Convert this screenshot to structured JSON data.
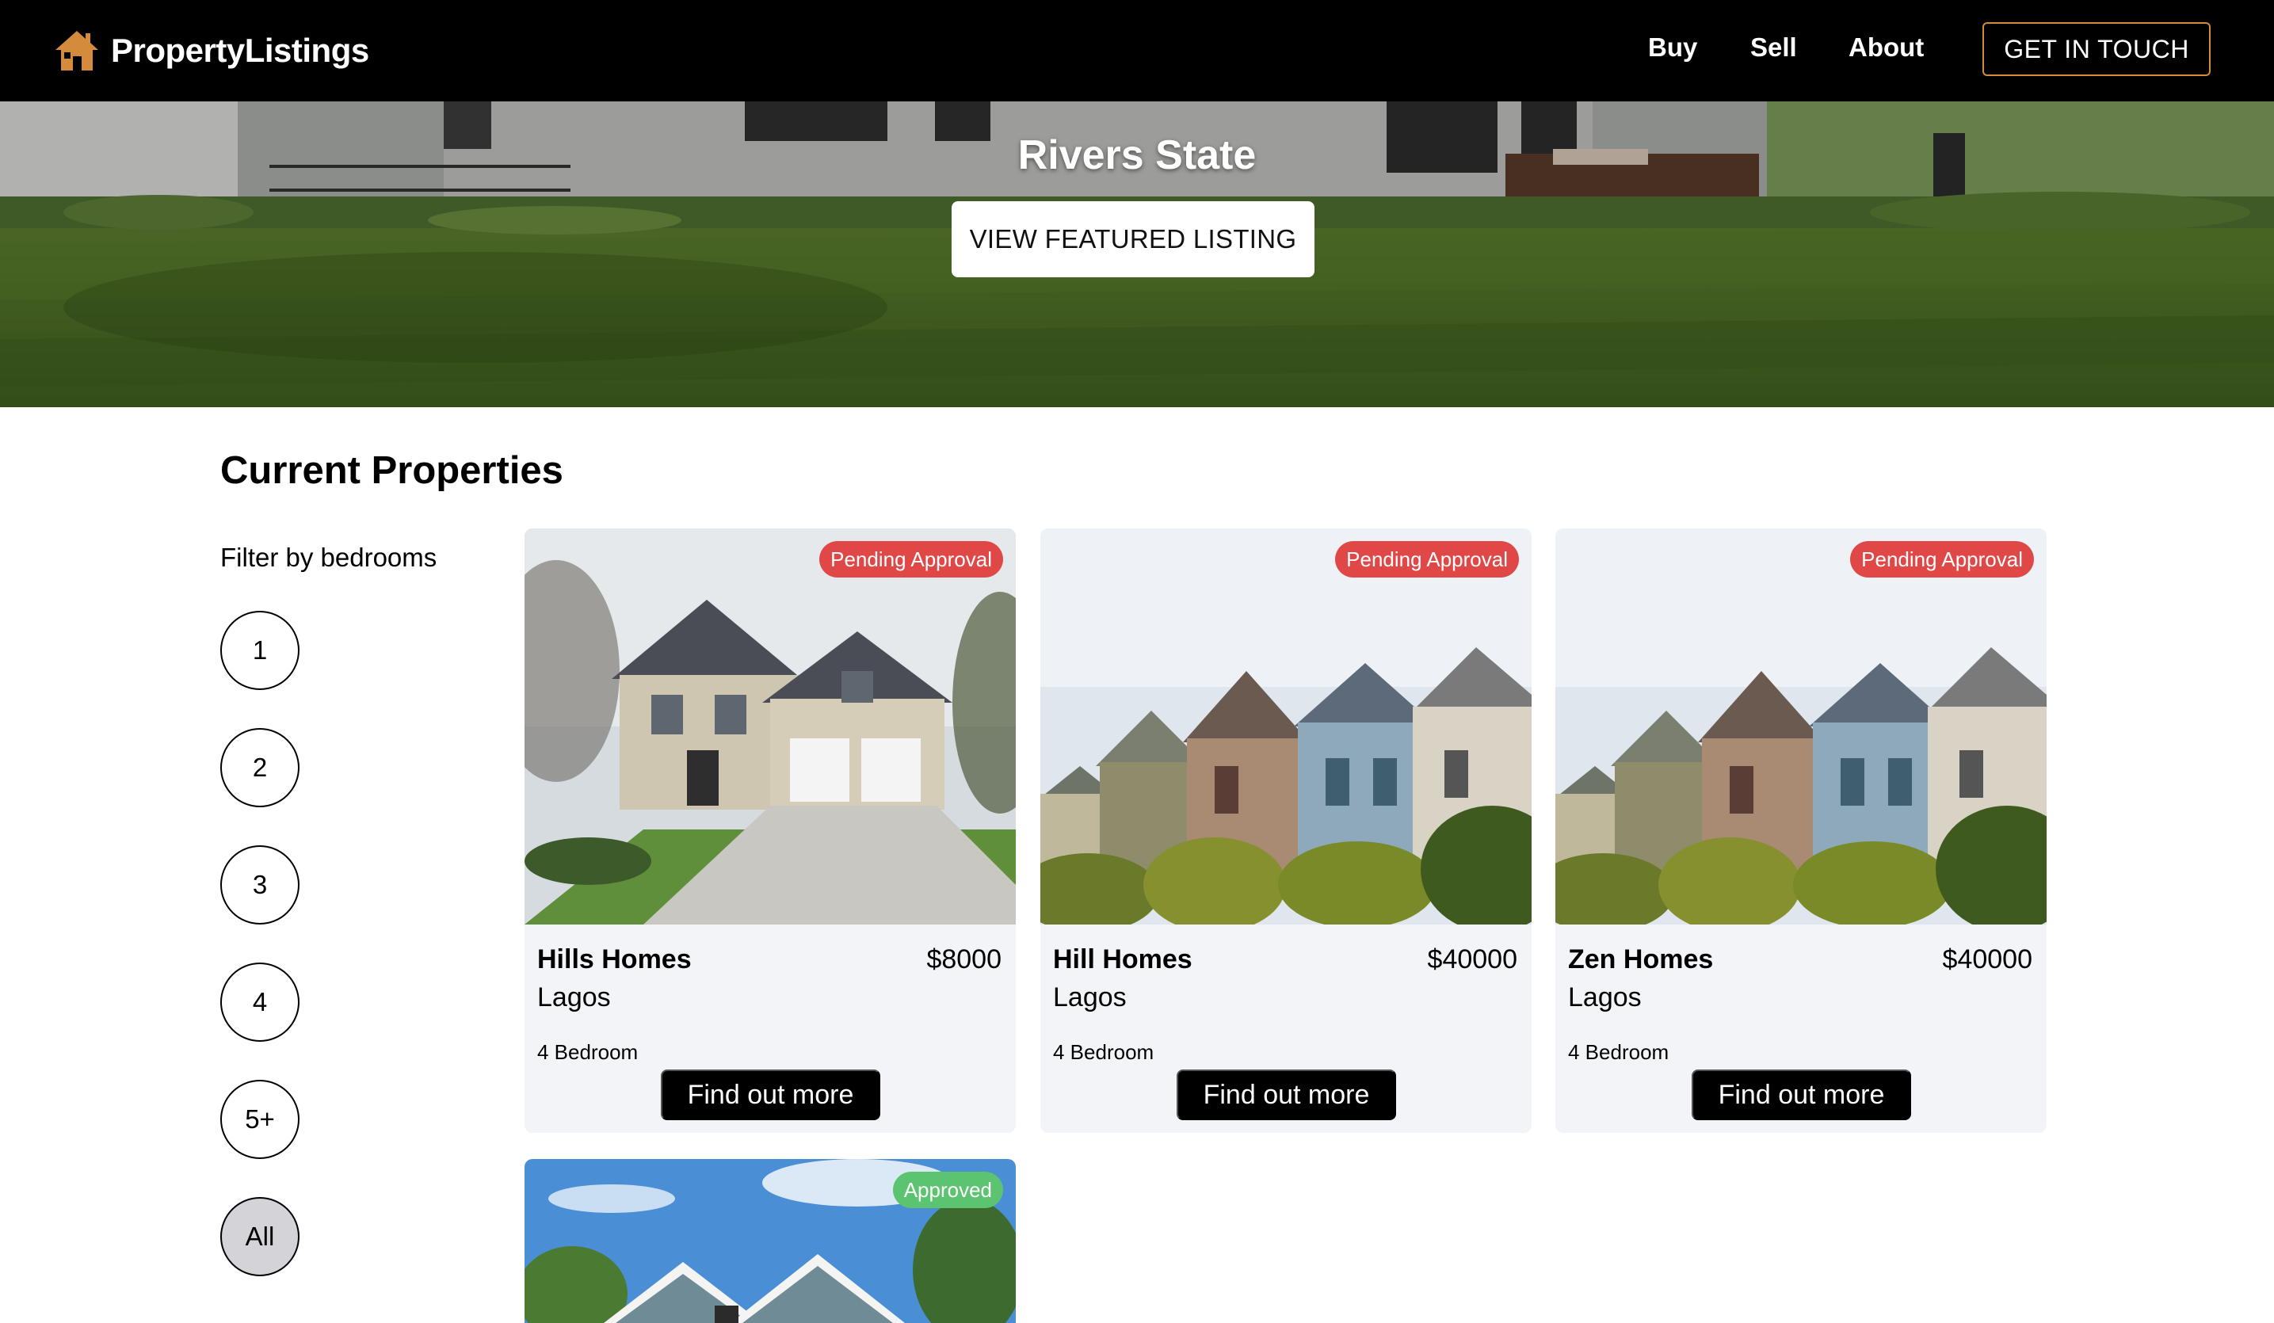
{
  "brand": {
    "name": "PropertyListings",
    "icon": "house-icon",
    "icon_color": "#d58b3c"
  },
  "nav": {
    "buy": "Buy",
    "sell": "Sell",
    "about": "About",
    "cta": "GET IN TOUCH"
  },
  "hero": {
    "title": "Rivers State",
    "button": "VIEW FEATURED LISTING"
  },
  "section": {
    "title": "Current Properties"
  },
  "filter": {
    "label": "Filter by bedrooms",
    "options": [
      "1",
      "2",
      "3",
      "4",
      "5+",
      "All"
    ],
    "selected": "All"
  },
  "properties": [
    {
      "name": "Hills Homes",
      "price": "$8000",
      "location": "Lagos",
      "bedrooms": "4 Bedroom",
      "status": "Pending Approval",
      "button": "Find out more"
    },
    {
      "name": "Hill Homes",
      "price": "$40000",
      "location": "Lagos",
      "bedrooms": "4 Bedroom",
      "status": "Pending Approval",
      "button": "Find out more"
    },
    {
      "name": "Zen Homes",
      "price": "$40000",
      "location": "Lagos",
      "bedrooms": "4 Bedroom",
      "status": "Pending Approval",
      "button": "Find out more"
    },
    {
      "status": "Approved"
    }
  ],
  "colors": {
    "accent": "#d58b3c",
    "pending": "#e04848",
    "approved": "#5cc470",
    "card_bg": "#f2f4f8"
  }
}
